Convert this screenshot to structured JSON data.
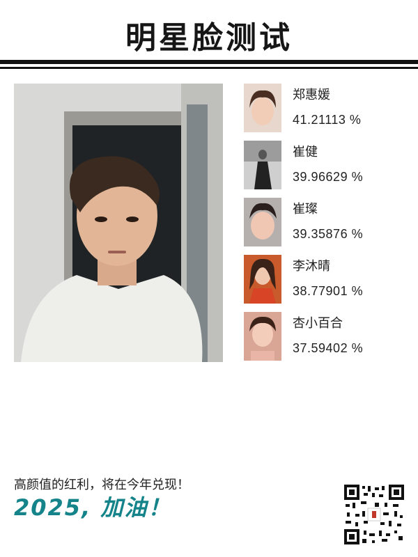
{
  "page": {
    "title": "明星脸测试"
  },
  "results": [
    {
      "name": "郑惠媛",
      "score": "41.21113 %"
    },
    {
      "name": "崔健",
      "score": "39.96629 %"
    },
    {
      "name": "崔璨",
      "score": "39.35876 %"
    },
    {
      "name": "李沐晴",
      "score": "38.77901 %"
    },
    {
      "name": "杏小百合",
      "score": "37.59402 %"
    }
  ],
  "footer": {
    "slogan": "高颜值的红利，将在今年兑现！",
    "cheer": "2025, 加油！"
  },
  "colors": {
    "accent": "#14848a",
    "rule": "#111111"
  },
  "icons": {
    "qr": "qr-code-icon"
  }
}
